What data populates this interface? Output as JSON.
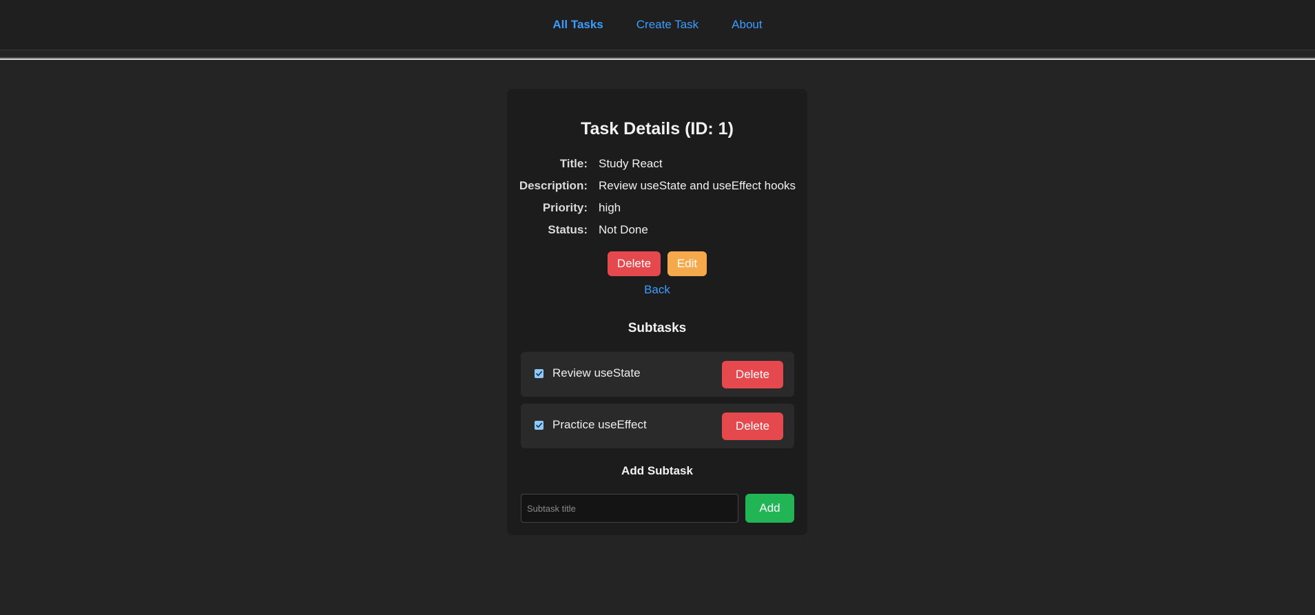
{
  "nav": {
    "links": [
      {
        "label": "All Tasks",
        "active": true
      },
      {
        "label": "Create Task",
        "active": false
      },
      {
        "label": "About",
        "active": false
      }
    ]
  },
  "task": {
    "heading": "Task Details (ID: 1)",
    "fields": [
      {
        "label": "Title:",
        "value": "Study React"
      },
      {
        "label": "Description:",
        "value": "Review useState and useEffect hooks"
      },
      {
        "label": "Priority:",
        "value": "high"
      },
      {
        "label": "Status:",
        "value": "Not Done"
      }
    ],
    "delete_label": "Delete",
    "edit_label": "Edit",
    "back_label": "Back"
  },
  "subtasks": {
    "heading": "Subtasks",
    "items": [
      {
        "title": "Review useState",
        "checked": true,
        "delete_label": "Delete"
      },
      {
        "title": "Practice useEffect",
        "checked": true,
        "delete_label": "Delete"
      }
    ]
  },
  "add_subtask": {
    "heading": "Add Subtask",
    "placeholder": "Subtask title",
    "value": "",
    "button_label": "Add"
  },
  "colors": {
    "background": "#242424",
    "card": "#1c1c1c",
    "link": "#3b9eff",
    "danger": "#e5484d",
    "warning": "#f5a94a",
    "success": "#22b556"
  }
}
